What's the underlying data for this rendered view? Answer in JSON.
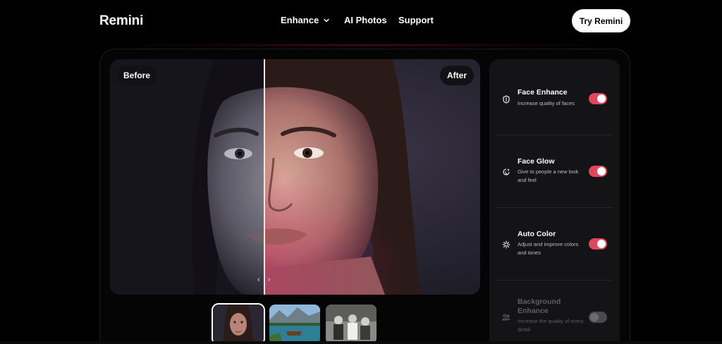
{
  "header": {
    "logo": "Remini",
    "nav": [
      {
        "label": "Enhance",
        "has_dropdown": true
      },
      {
        "label": "AI Photos"
      },
      {
        "label": "Support"
      }
    ],
    "cta_label": "Try Remini"
  },
  "viewer": {
    "before_label": "Before",
    "after_label": "After",
    "arrows": "‹ ›"
  },
  "thumbnails": [
    {
      "name": "portrait",
      "active": true
    },
    {
      "name": "lake-landscape",
      "active": false
    },
    {
      "name": "vintage-group-photo",
      "active": false
    }
  ],
  "features": [
    {
      "title": "Face Enhance",
      "description": "Increase quality of faces",
      "enabled": true,
      "icon": "shield-icon"
    },
    {
      "title": "Face Glow",
      "description": "Give to people a new look and feel",
      "enabled": true,
      "icon": "glow-icon"
    },
    {
      "title": "Auto Color",
      "description": "Adjust and improve colors and tones",
      "enabled": true,
      "icon": "sparkle-icon"
    },
    {
      "title": "Background Enhance",
      "description": "Increase the quality of every detail",
      "enabled": false,
      "icon": "people-icon"
    }
  ],
  "colors": {
    "accent": "#e0465e",
    "background": "#000000",
    "panel": "#141417",
    "button": "#ffffff"
  }
}
